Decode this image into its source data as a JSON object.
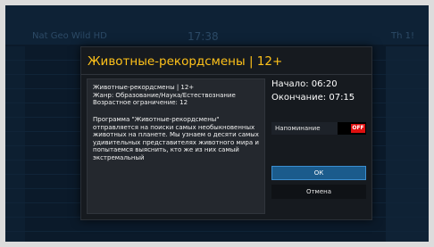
{
  "background": {
    "channel": "Nat Geo Wild HD",
    "time": "17:38",
    "date": "Th 1!"
  },
  "dialog": {
    "title": "Животные-рекордсмены | 12+",
    "meta": "Животные-рекордсмены | 12+\nЖанр: Образование/Наука/Естествознание\nВозрастное ограничение: 12",
    "description": "Программа \"Животные-рекордсмены\"\nотправляется на поиски самых необыкновенных\nживотных на планете. Мы узнаем о десяти самых\nудивительных представителях животного мира и\nпопытаемся выяснить, кто же из них самый\nэкстремальный",
    "start": "Начало: 06:20",
    "end": "Окончание: 07:15",
    "reminder_label": "Напоминание",
    "reminder_state": "OFF",
    "ok_label": "ОК",
    "cancel_label": "Отмена"
  },
  "colors": {
    "title": "#ffc21a",
    "toggle_off": "#e01010",
    "ok_button": "#1b5b8c"
  }
}
